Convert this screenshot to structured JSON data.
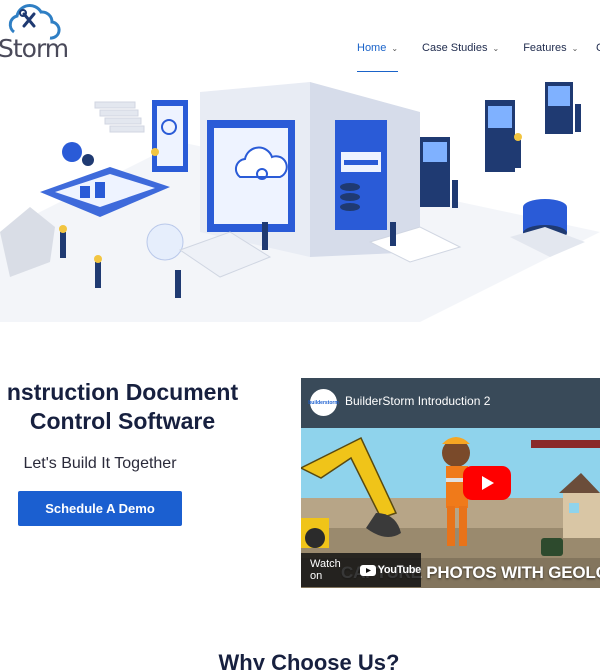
{
  "header": {
    "logo_text": "Storm",
    "nav": [
      {
        "label": "Home",
        "active": true
      },
      {
        "label": "Case Studies",
        "active": false
      },
      {
        "label": "Features",
        "active": false
      }
    ],
    "nav_partial": "C"
  },
  "hero": {
    "headline_line1": "nstruction Document",
    "headline_line2": "Control Software",
    "tagline": "Let's Build It Together",
    "cta_label": "Schedule A Demo"
  },
  "video": {
    "title": "BuilderStorm Introduction 2",
    "channel_badge": "builderstorm",
    "watch_label": "Watch on",
    "platform": "YouTube",
    "caption_overlay": "CAPTURE PHOTOS WITH GEOLOC"
  },
  "section": {
    "why_title": "Why Choose Us?"
  },
  "colors": {
    "accent": "#1b5fd0",
    "nav_active": "#1a63c9",
    "heading": "#17203f",
    "youtube_red": "#ff0000"
  }
}
